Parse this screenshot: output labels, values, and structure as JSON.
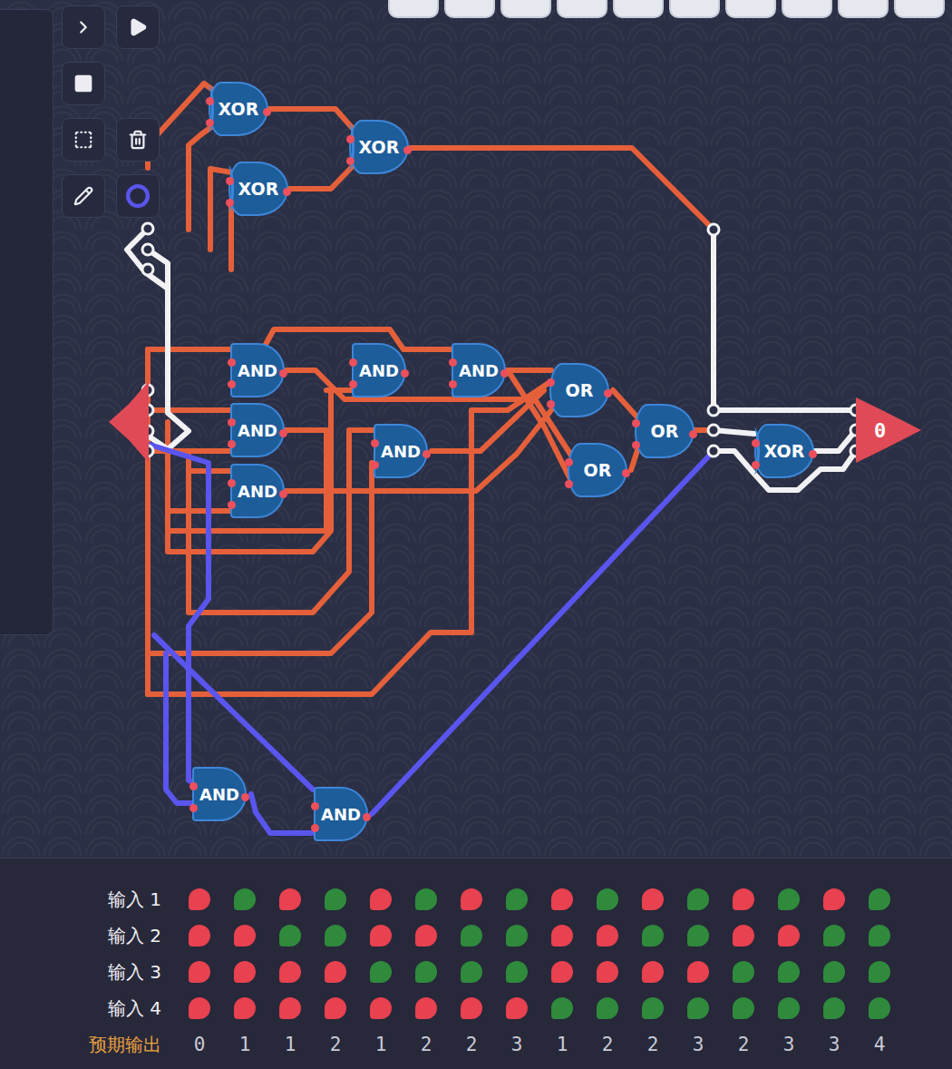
{
  "gates": [
    {
      "label": "XOR",
      "kind": "xor"
    },
    {
      "label": "XOR",
      "kind": "xor"
    },
    {
      "label": "XOR",
      "kind": "xor"
    },
    {
      "label": "AND",
      "kind": "and"
    },
    {
      "label": "AND",
      "kind": "and"
    },
    {
      "label": "AND",
      "kind": "and"
    },
    {
      "label": "AND",
      "kind": "and"
    },
    {
      "label": "AND",
      "kind": "and"
    },
    {
      "label": "AND",
      "kind": "and"
    },
    {
      "label": "OR",
      "kind": "or"
    },
    {
      "label": "OR",
      "kind": "or"
    },
    {
      "label": "OR",
      "kind": "or"
    },
    {
      "label": "XOR",
      "kind": "xor"
    },
    {
      "label": "AND",
      "kind": "and"
    },
    {
      "label": "AND",
      "kind": "and"
    }
  ],
  "output": {
    "value": "0"
  },
  "truth_table": {
    "inputs": [
      {
        "label": "输入 1",
        "values": [
          false,
          true,
          false,
          true,
          false,
          true,
          false,
          true,
          false,
          true,
          false,
          true,
          false,
          true,
          false,
          true
        ]
      },
      {
        "label": "输入 2",
        "values": [
          false,
          false,
          true,
          true,
          false,
          false,
          true,
          true,
          false,
          false,
          true,
          true,
          false,
          false,
          true,
          true
        ]
      },
      {
        "label": "输入 3",
        "values": [
          false,
          false,
          false,
          false,
          true,
          true,
          true,
          true,
          false,
          false,
          false,
          false,
          true,
          true,
          true,
          true
        ]
      },
      {
        "label": "输入 4",
        "values": [
          false,
          false,
          false,
          false,
          false,
          false,
          false,
          false,
          true,
          true,
          true,
          true,
          true,
          true,
          true,
          true
        ]
      }
    ],
    "expected": {
      "label": "预期输出",
      "values": [
        "0",
        "1",
        "1",
        "2",
        "1",
        "2",
        "2",
        "3",
        "1",
        "2",
        "2",
        "3",
        "2",
        "3",
        "3",
        "4"
      ]
    }
  }
}
